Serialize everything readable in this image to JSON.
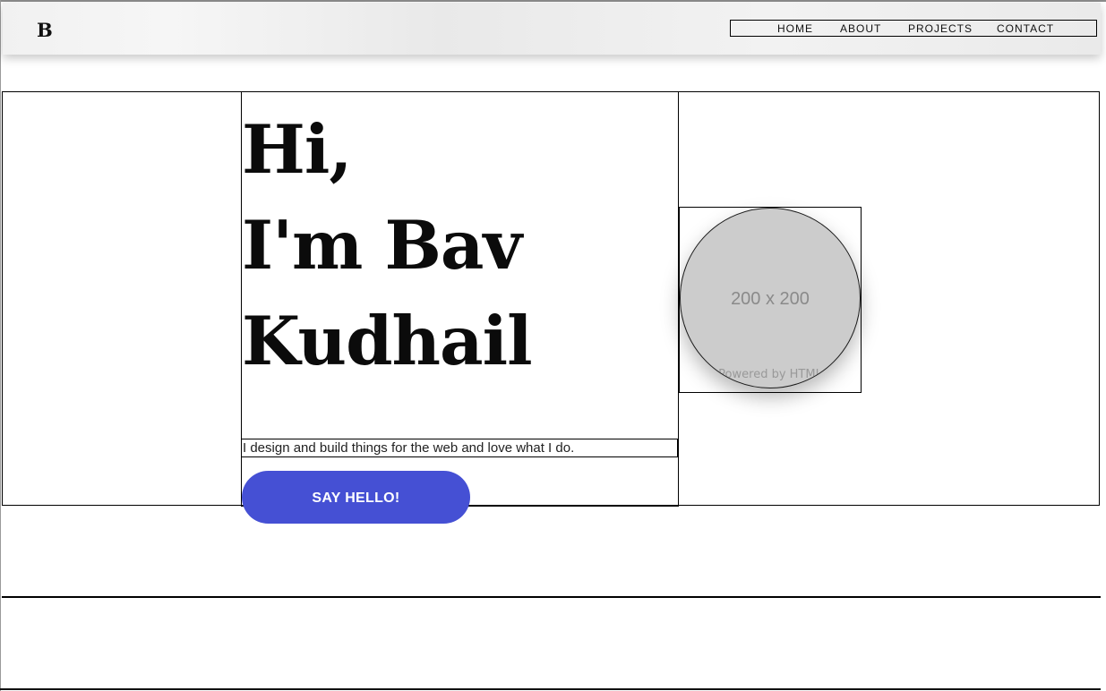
{
  "brand": {
    "logo_text": "B"
  },
  "nav": {
    "items": [
      {
        "label": "HOME"
      },
      {
        "label": "ABOUT"
      },
      {
        "label": "PROJECTS"
      },
      {
        "label": "CONTACT"
      }
    ]
  },
  "hero": {
    "heading_lines": [
      "Hi,",
      "I'm Bav",
      "Kudhail"
    ],
    "tagline": "I design and build things for the web and love what I do.",
    "cta_label": "SAY HELLO!",
    "cta_color": "#4550d4"
  },
  "avatar": {
    "placeholder_text": "200 x 200",
    "watermark_text": "Powered by HTML"
  }
}
